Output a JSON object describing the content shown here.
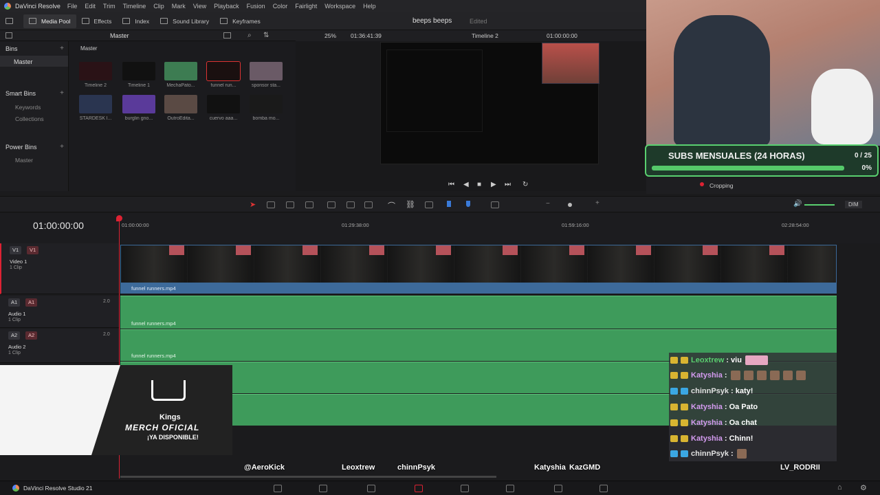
{
  "app": {
    "title": "DaVinci Resolve",
    "product": "DaVinci Resolve Studio 21"
  },
  "menu": [
    "File",
    "Edit",
    "Trim",
    "Timeline",
    "Clip",
    "Mark",
    "View",
    "Playback",
    "Fusion",
    "Color",
    "Fairlight",
    "Workspace",
    "Help"
  ],
  "toolbar": {
    "media_pool": "Media Pool",
    "effects": "Effects",
    "index": "Index",
    "sound_library": "Sound Library",
    "keyframes": "Keyframes"
  },
  "project": {
    "name": "beeps beeps",
    "status": "Edited"
  },
  "media_pool": {
    "path": "Master",
    "bins_label": "Bins",
    "master": "Master",
    "smart_bins_label": "Smart Bins",
    "keywords": "Keywords",
    "collections": "Collections",
    "power_bins_label": "Power Bins",
    "power_master": "Master",
    "clips": [
      {
        "label": "Timeline 2",
        "color": "#2a1216"
      },
      {
        "label": "Timeline 1",
        "color": "#111111"
      },
      {
        "label": "MechaPato...",
        "color": "#3d7c52"
      },
      {
        "label": "funnel run...",
        "color": "#1a1010"
      },
      {
        "label": "sponsor sta...",
        "color": "#6a5a66"
      },
      {
        "label": "STARDESK l...",
        "color": "#2a3550"
      },
      {
        "label": "burglin gno...",
        "color": "#5a3a9a"
      },
      {
        "label": "OutroEdita...",
        "color": "#5a4a44"
      },
      {
        "label": "cuervo aaa...",
        "color": "#111111"
      },
      {
        "label": "bomba mo...",
        "color": "#1a1a1a"
      }
    ]
  },
  "viewer": {
    "zoom": "25%",
    "source_tc": "01:36:41:39",
    "timeline_name": "Timeline 2",
    "record_tc": "01:00:00:00"
  },
  "overlay_subs": {
    "title": "SUBS MENSUALES (24 HORAS)",
    "count": "0 / 25",
    "percent": "0%",
    "progress": 0.0
  },
  "inspector": {
    "cropping_label": "Cropping"
  },
  "timeline": {
    "timecode": "01:00:00:00",
    "ruler": [
      "01:00:00:00",
      "01:29:38:00",
      "01:59:16:00",
      "02:28:54:00"
    ],
    "mode": "DIM",
    "tracks": [
      {
        "id": "V1",
        "name": "Video 1",
        "clips": "1 Clip",
        "clip_name": "funnel runners.mp4"
      },
      {
        "id": "A1",
        "name": "Audio 1",
        "clips": "1 Clip",
        "level": "2.0",
        "clip_name": "funnel runners.mp4"
      },
      {
        "id": "A2",
        "name": "Audio 2",
        "clips": "1 Clip",
        "level": "2.0",
        "clip_name": "funnel runners.mp4"
      }
    ]
  },
  "merch": {
    "brand": "Kings",
    "line1": "MERCH OFICIAL",
    "line2": "¡YA DISPONIBLE!"
  },
  "chat": [
    {
      "user": "Leoxtrew",
      "text": ": viu",
      "color": "#5ad170",
      "badge": "b1",
      "emotes": 1,
      "pink": true
    },
    {
      "user": "Katyshia",
      "text": ":",
      "color": "#d49bf0",
      "badge": "b1",
      "emotes": 6,
      "pink": false
    },
    {
      "user": "chinnPsyk",
      "text": ": katy!",
      "color": "#e0e0e0",
      "badge": "b2",
      "emotes": 0,
      "pink": false
    },
    {
      "user": "Katyshia",
      "text": ": Oa Pato",
      "color": "#d49bf0",
      "badge": "b1",
      "emotes": 0,
      "pink": false
    },
    {
      "user": "Katyshia",
      "text": ": Oa chat",
      "color": "#d49bf0",
      "badge": "b1",
      "emotes": 0,
      "pink": false
    },
    {
      "user": "Katyshia",
      "text": ": Chinn!",
      "color": "#d49bf0",
      "badge": "b1",
      "emotes": 0,
      "pink": false
    },
    {
      "user": "chinnPsyk",
      "text": ":",
      "color": "#e0e0e0",
      "badge": "b2",
      "emotes": 1,
      "pink": false
    }
  ],
  "viewer_names": [
    "@AeroKick",
    "Leoxtrew",
    "chinnPsyk",
    "Katyshia",
    "KazGMD",
    "LV_RODRII"
  ]
}
